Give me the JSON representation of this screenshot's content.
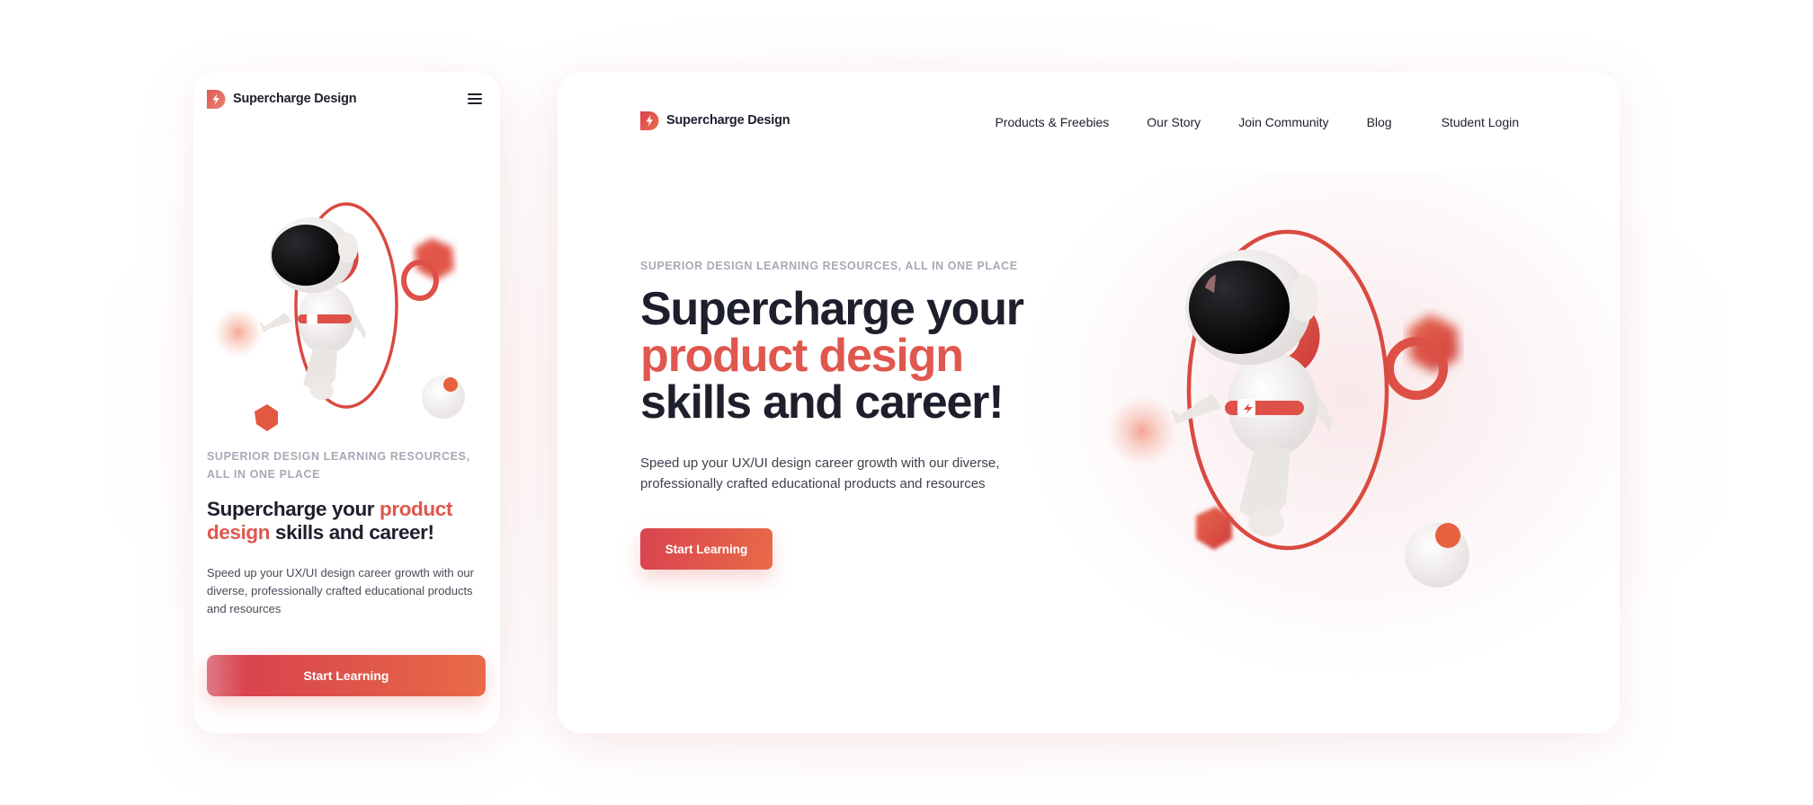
{
  "brand": {
    "name": "Supercharge Design",
    "logo_icon": "lightning-d-logo",
    "accent_color": "#e0574e",
    "button_gradient": [
      "#d9434f",
      "#e86b48"
    ]
  },
  "mobile": {
    "menu_icon": "hamburger-menu-icon",
    "eyebrow": "SUPERIOR DESIGN LEARNING RESOURCES, ALL IN ONE PLACE",
    "title_part1": "Supercharge your ",
    "title_accent": "product design",
    "title_part2": " skills and career!",
    "description": "Speed up your UX/UI design career growth with our diverse, professionally crafted educational products and resources",
    "cta_label": "Start Learning"
  },
  "desktop": {
    "nav": [
      {
        "label": "Products & Freebies"
      },
      {
        "label": "Our Story"
      },
      {
        "label": "Join Community"
      },
      {
        "label": "Blog"
      },
      {
        "label": "Student Login"
      }
    ],
    "eyebrow": "SUPERIOR DESIGN LEARNING RESOURCES, ALL IN ONE PLACE",
    "title_line1": "Supercharge your",
    "title_accent": "product design",
    "title_line3": "skills and career!",
    "description": "Speed up your UX/UI design career growth with our diverse, professionally crafted educational products and resources",
    "cta_label": "Start Learning"
  },
  "illustration": {
    "subject": "astronaut-floating-through-red-ring",
    "decorations": [
      "red-hexagon",
      "red-torus",
      "red-cube",
      "orange-sphere",
      "white-sphere",
      "blurred-orange-orb"
    ]
  }
}
